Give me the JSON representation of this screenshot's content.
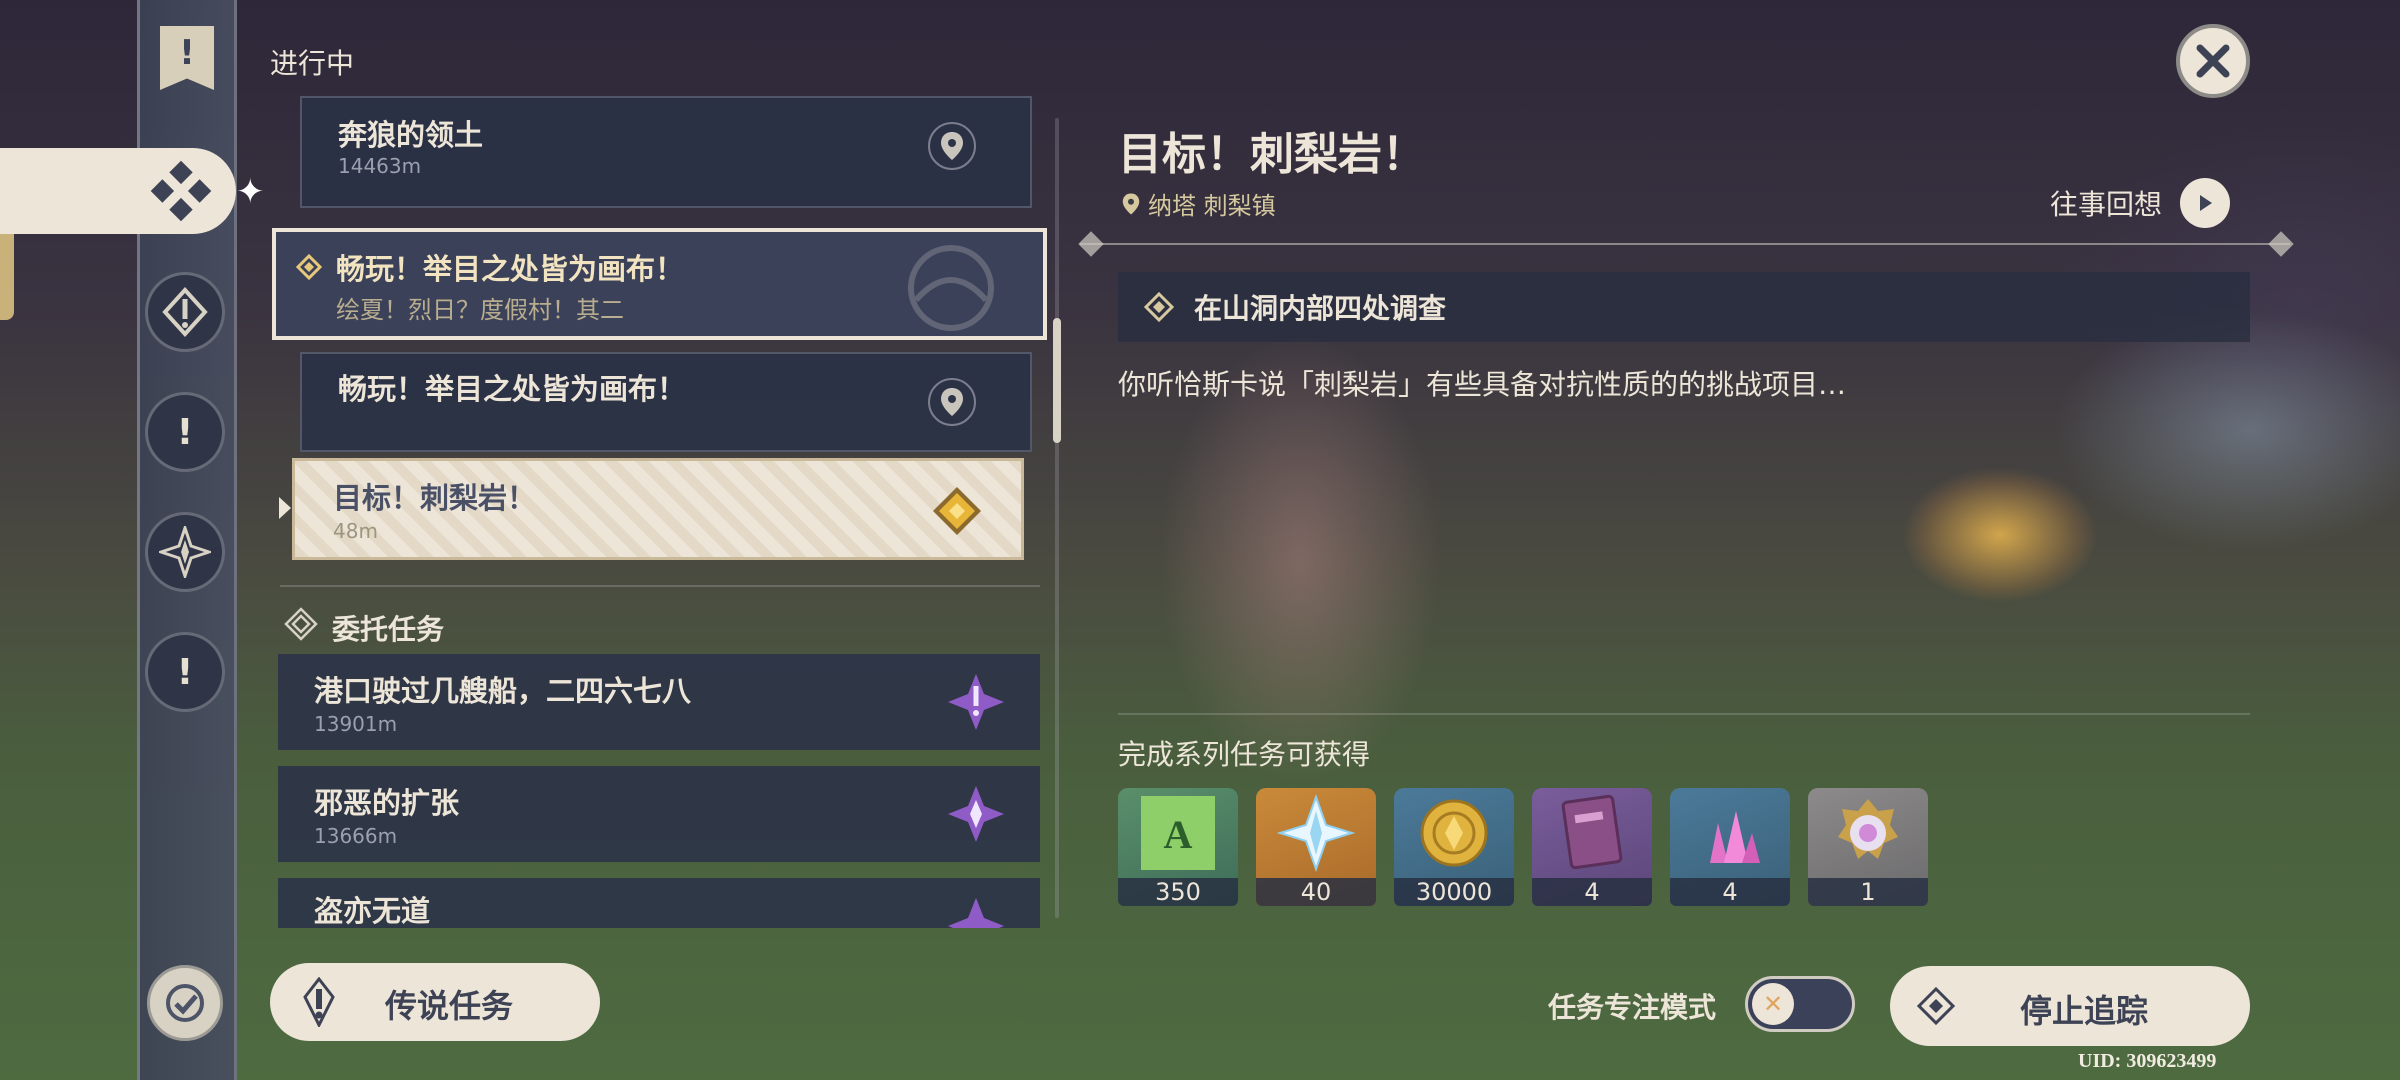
{
  "header": {
    "section_title": "进行中"
  },
  "quests": [
    {
      "title": "奔狼的领土",
      "distance": "14463m"
    },
    {
      "title": "畅玩！举目之处皆为画布！",
      "subtitle": "绘夏！烈日？度假村！其二"
    },
    {
      "title": "畅玩！举目之处皆为画布！"
    },
    {
      "title": "目标！刺梨岩！",
      "distance": "48m"
    }
  ],
  "commissions": {
    "header": "委托任务",
    "items": [
      {
        "title": "港口驶过几艘船，二四六七八",
        "distance": "13901m"
      },
      {
        "title": "邪恶的扩张",
        "distance": "13666m"
      },
      {
        "title": "盗亦无道"
      }
    ]
  },
  "detail": {
    "title": "目标！刺梨岩！",
    "location": "纳塔 刺梨镇",
    "recall_label": "往事回想",
    "objective": "在山洞内部四处调查",
    "description": "你听恰斯卡说「刺梨岩」有些具备对抗性质的的挑战项目…",
    "rewards_title": "完成系列任务可获得",
    "rewards": [
      {
        "icon": "adventure-exp-icon",
        "count": "350"
      },
      {
        "icon": "primogem-icon",
        "count": "40"
      },
      {
        "icon": "mora-icon",
        "count": "30000"
      },
      {
        "icon": "hero-wit-book-icon",
        "count": "4"
      },
      {
        "icon": "mystic-ore-icon",
        "count": "4"
      },
      {
        "icon": "namecard-badge-icon",
        "count": "1"
      }
    ]
  },
  "footer": {
    "legend_label": "传说任务",
    "focus_mode_label": "任务专注模式",
    "focus_mode_on": false,
    "stop_label": "停止追踪",
    "uid": "UID: 309623499"
  },
  "colors": {
    "cream": "#ece5d8",
    "panel": "#2a3246",
    "gold": "#c9a14a",
    "violet": "#b07ce0"
  }
}
